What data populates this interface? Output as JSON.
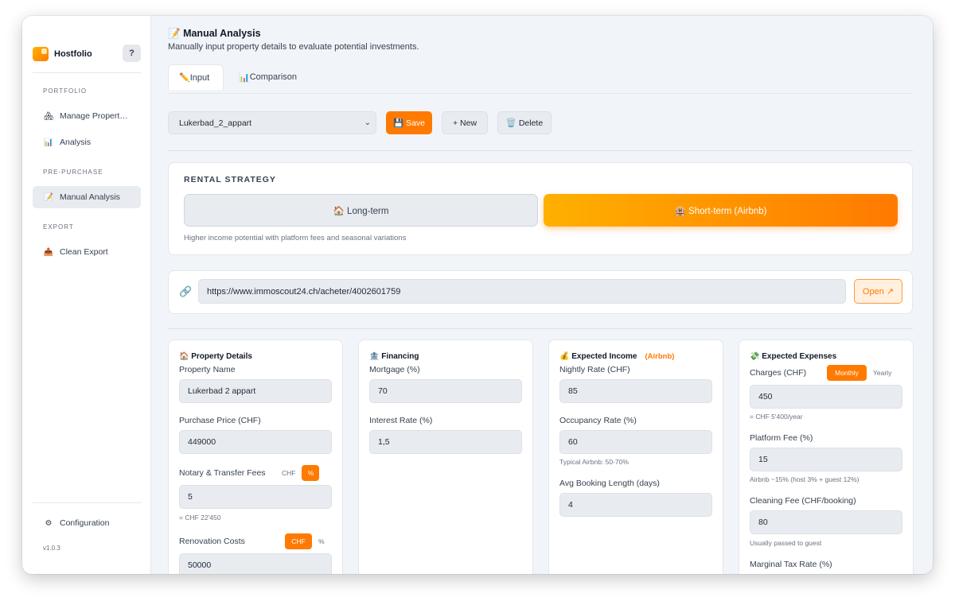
{
  "app": {
    "name": "Hostfolio",
    "help_label": "?",
    "version": "v1.0.3"
  },
  "sidebar": {
    "sections": [
      {
        "title": "PORTFOLIO",
        "items": [
          {
            "icon": "🏘",
            "label": "Manage Propert…"
          },
          {
            "icon": "📊",
            "label": "Analysis"
          }
        ]
      },
      {
        "title": "PRE-PURCHASE",
        "items": [
          {
            "icon": "📝",
            "label": "Manual Analysis",
            "active": true
          }
        ]
      },
      {
        "title": "EXPORT",
        "items": [
          {
            "icon": "📤",
            "label": "Clean Export"
          }
        ]
      }
    ],
    "configuration": {
      "icon": "⚙",
      "label": "Configuration"
    }
  },
  "page": {
    "icon": "📝",
    "title": "Manual Analysis",
    "subtitle": "Manually input property details to evaluate potential investments."
  },
  "tabs": [
    {
      "icon": "✏️",
      "label": "Input",
      "active": true
    },
    {
      "icon": "📊",
      "label": "Comparison"
    }
  ],
  "toolbar": {
    "selected_property": "Lukerbad_2_appart",
    "save_label": "💾 Save",
    "new_label": "+ New",
    "delete_label": "🗑️ Delete"
  },
  "strategy": {
    "label": "RENTAL STRATEGY",
    "long_term": "🏠 Long-term",
    "short_term": "🏨 Short-term (Airbnb)",
    "selected": "short_term",
    "description": "Higher income potential with platform fees and seasonal variations"
  },
  "listing": {
    "url": "https://www.immoscout24.ch/acheter/4002601759",
    "open_label": "Open ↗"
  },
  "property": {
    "title": "🏠 Property Details",
    "name_label": "Property Name",
    "name_value": "Lukerbad 2 appart",
    "price_label": "Purchase Price (CHF)",
    "price_value": "449000",
    "fees_label": "Notary & Transfer Fees",
    "fees_value": "5",
    "fees_hint": "= CHF 22'450",
    "fees_toggle": {
      "chf": "CHF",
      "pct": "%",
      "selected": "pct"
    },
    "reno_label": "Renovation Costs",
    "reno_value": "50000",
    "reno_toggle": {
      "chf": "CHF",
      "pct": "%",
      "selected": "chf"
    }
  },
  "financing": {
    "title": "🏦 Financing",
    "mortgage_label": "Mortgage (%)",
    "mortgage_value": "70",
    "rate_label": "Interest Rate (%)",
    "rate_value": "1,5"
  },
  "income": {
    "title": "💰 Expected Income",
    "tag": "(Airbnb)",
    "nightly_label": "Nightly Rate (CHF)",
    "nightly_value": "85",
    "occupancy_label": "Occupancy Rate (%)",
    "occupancy_value": "60",
    "occupancy_hint": "Typical Airbnb: 50-70%",
    "booking_label": "Avg Booking Length (days)",
    "booking_value": "4"
  },
  "expenses": {
    "title": "💸 Expected Expenses",
    "charges_label": "Charges (CHF)",
    "charges_value": "450",
    "charges_hint": "= CHF 5'400/year",
    "charges_toggle": {
      "monthly": "Monthly",
      "yearly": "Yearly",
      "selected": "monthly"
    },
    "platform_label": "Platform Fee (%)",
    "platform_value": "15",
    "platform_hint": "Airbnb ~15% (host 3% + guest 12%)",
    "cleaning_label": "Cleaning Fee (CHF/booking)",
    "cleaning_value": "80",
    "cleaning_hint": "Usually passed to guest",
    "tax_label": "Marginal Tax Rate (%)"
  }
}
